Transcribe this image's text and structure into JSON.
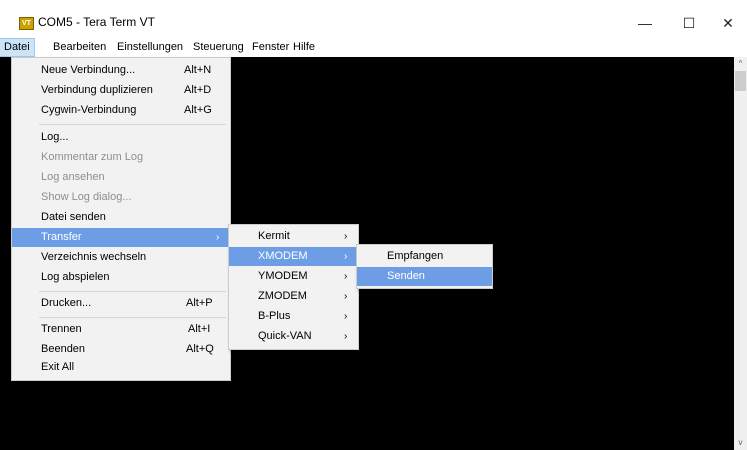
{
  "window": {
    "title": "COM5 - Tera Term VT",
    "icon_label": "VT",
    "minimize": "—",
    "maximize": "☐",
    "close": "✕"
  },
  "menubar": [
    "Datei",
    "Bearbeiten",
    "Einstellungen",
    "Steuerung",
    "Fenster",
    "Hilfe"
  ],
  "file_menu": [
    {
      "label": "Neue Verbindung...",
      "accel": "Alt+N"
    },
    {
      "label": "Verbindung duplizieren",
      "accel": "Alt+D"
    },
    {
      "label": "Cygwin-Verbindung",
      "accel": "Alt+G"
    },
    {
      "label": "Log..."
    },
    {
      "label": "Kommentar zum Log",
      "disabled": true
    },
    {
      "label": "Log ansehen",
      "disabled": true
    },
    {
      "label": "Show Log dialog...",
      "disabled": true
    },
    {
      "label": "Datei senden"
    },
    {
      "label": "Transfer"
    },
    {
      "label": "Verzeichnis wechseln"
    },
    {
      "label": "Log abspielen"
    },
    {
      "label": "Drucken...",
      "accel": "Alt+P"
    },
    {
      "label": "Trennen",
      "accel": "Alt+I"
    },
    {
      "label": "Beenden",
      "accel": "Alt+Q"
    },
    {
      "label": "Exit All"
    }
  ],
  "transfer_menu": [
    "Kermit",
    "XMODEM",
    "YMODEM",
    "ZMODEM",
    "B-Plus",
    "Quick-VAN"
  ],
  "xmodem_menu": [
    "Empfangen",
    "Senden"
  ]
}
